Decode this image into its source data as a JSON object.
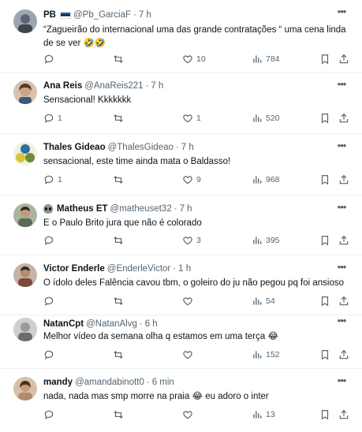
{
  "feed": {
    "tweets": [
      {
        "name": "PB",
        "handle": "@Pb_GarciaF",
        "time": "7 h",
        "text": "“Zagueirão do internacional uma das grande contratações “ uma cena linda de se ver 🤣🤣",
        "stats": {
          "replies": "",
          "retweets": "",
          "likes": "10",
          "views": "784"
        },
        "avatar_color": "#9aa7b0"
      },
      {
        "name": "Ana Reis",
        "handle": "@AnaReis221",
        "time": "7 h",
        "text": "Sensacional! Kkkkkkk",
        "stats": {
          "replies": "1",
          "retweets": "",
          "likes": "1",
          "views": "520"
        },
        "avatar_color": "#c9a58a"
      },
      {
        "name": "Thales Gideao",
        "handle": "@ThalesGideao",
        "time": "7 h",
        "text": "sensacional, este time ainda mata o Baldasso!",
        "stats": {
          "replies": "1",
          "retweets": "",
          "likes": "9",
          "views": "968"
        },
        "avatar_color": "#6d8a3a"
      },
      {
        "name": "Matheus ET",
        "handle": "@matheuset32",
        "time": "7 h",
        "text": "E o Paulo Brito jura que não é colorado",
        "stats": {
          "replies": "",
          "retweets": "",
          "likes": "3",
          "views": "395"
        },
        "avatar_color": "#5b6b5a"
      },
      {
        "name": "Victor Enderle",
        "handle": "@EnderleVictor",
        "time": "1 h",
        "text": "O ídolo deles Falência cavou tbm, o goleiro do ju não pegou pq foi ansioso",
        "stats": {
          "replies": "",
          "retweets": "",
          "likes": "",
          "views": "54"
        },
        "avatar_color": "#7a4a3c"
      },
      {
        "name": "NatanCpt",
        "handle": "@NatanAlvg",
        "time": "6 h",
        "text": "Melhor vídeo da semana olha q estamos em uma terça 😂",
        "stats": {
          "replies": "",
          "retweets": "",
          "likes": "",
          "views": "152"
        },
        "avatar_color": "#8c8c8c"
      },
      {
        "name": "mandy",
        "handle": "@amandabinott0",
        "time": "6 min",
        "text": "nada, nada mas smp morre na praia 😂 eu adoro o inter",
        "stats": {
          "replies": "",
          "retweets": "",
          "likes": "",
          "views": "13"
        },
        "avatar_color": "#b08a6a"
      }
    ]
  },
  "icons": {
    "more": "more-dots-icon",
    "reply": "reply-icon",
    "retweet": "retweet-icon",
    "like": "heart-icon",
    "views": "views-bar-icon",
    "bookmark": "bookmark-icon",
    "share": "share-icon"
  },
  "separator": "·",
  "colors": {
    "text": "#0f1419",
    "secondary": "#536471",
    "border": "#eff3f4"
  }
}
